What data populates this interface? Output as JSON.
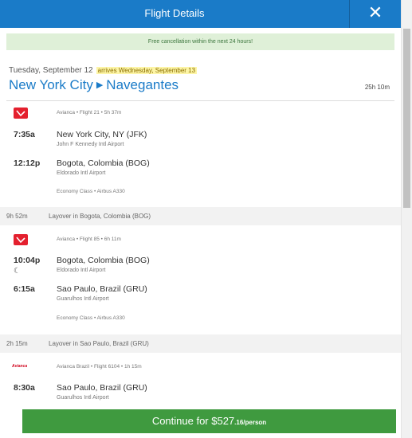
{
  "header": {
    "title": "Flight Details",
    "close_glyph": "✕"
  },
  "notice": "Free cancellation within the next 24 hours!",
  "trip": {
    "date": "Tuesday, September 12",
    "arrives": "arrives Wednesday, September 13",
    "origin": "New York City",
    "destination": "Navegantes",
    "total_duration": "25h 10m"
  },
  "segments": [
    {
      "airline_icon": "avianca-logo-icon",
      "meta": "Avianca • Flight 21 • 5h 37m",
      "depart_time": "7:35a",
      "depart_city": "New York City, NY (JFK)",
      "depart_airport": "John F Kennedy Intl Airport",
      "arrive_time": "12:12p",
      "arrive_city": "Bogota, Colombia (BOG)",
      "arrive_airport": "Eldorado Intl Airport",
      "cabin": "Economy Class • Airbus A330"
    },
    {
      "airline_icon": "avianca-logo-icon",
      "meta": "Avianca • Flight 85 • 6h 11m",
      "depart_time": "10:04p",
      "depart_city": "Bogota, Colombia (BOG)",
      "depart_airport": "Eldorado Intl Airport",
      "overnight_icon": "moon-icon",
      "arrive_time": "6:15a",
      "arrive_city": "Sao Paulo, Brazil (GRU)",
      "arrive_airport": "Guarulhos Intl Airport",
      "cabin": "Economy Class • Airbus A330"
    },
    {
      "airline_icon": "avianca-brazil-logo-icon",
      "airline_word": "Avianca",
      "meta": "Avianca Brazil • Flight 6104 • 1h 15m",
      "depart_time": "8:30a",
      "depart_city": "Sao Paulo, Brazil (GRU)",
      "depart_airport": "Guarulhos Intl Airport"
    }
  ],
  "layovers": [
    {
      "duration": "9h 52m",
      "description": "Layover in Bogota, Colombia (BOG)"
    },
    {
      "duration": "2h 15m",
      "description": "Layover in Sao Paulo, Brazil (GRU)"
    }
  ],
  "footer": {
    "button_prefix": "Continue for $527",
    "button_cents": ".16/person"
  },
  "colors": {
    "brand_blue": "#1a7bc8",
    "notice_green": "#dff0d8",
    "cta_green": "#3f9a3f",
    "airline_red": "#e4202e"
  }
}
